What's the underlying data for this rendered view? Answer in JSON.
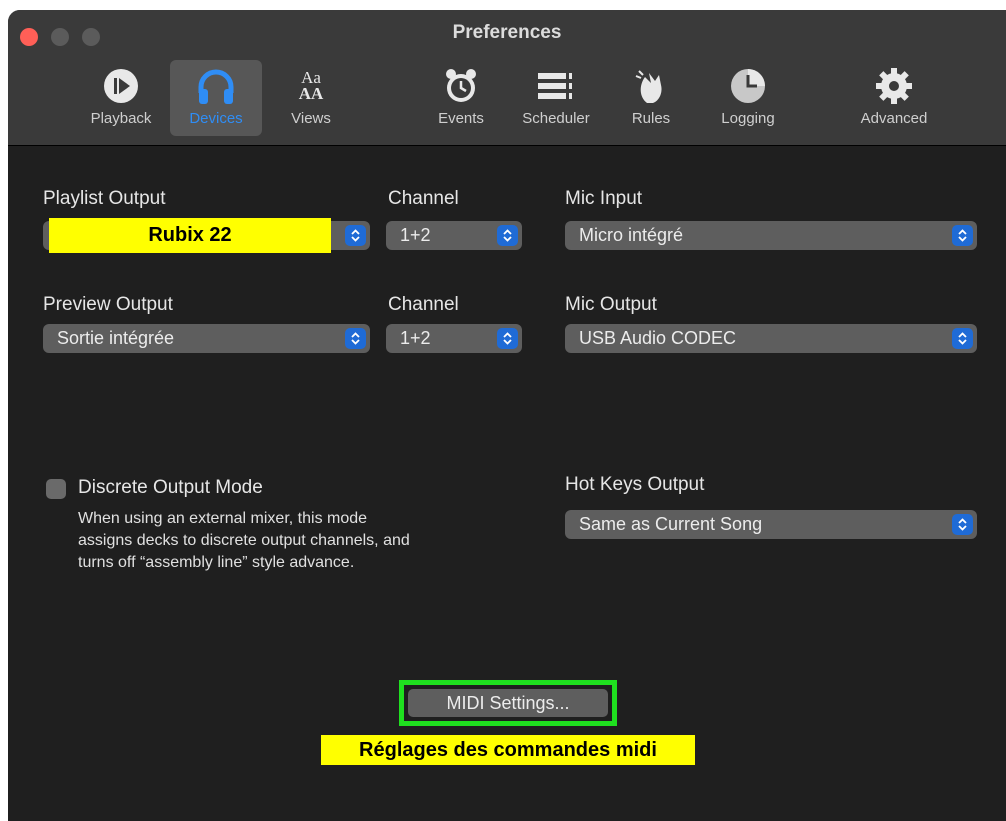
{
  "window": {
    "title": "Preferences"
  },
  "toolbar": {
    "tabs": [
      {
        "label": "Playback",
        "icon": "play-circle-icon"
      },
      {
        "label": "Devices",
        "icon": "headphones-icon"
      },
      {
        "label": "Views",
        "icon": "font-size-icon",
        "glyph_top": "Aa",
        "glyph_bottom": "AA"
      },
      {
        "label": "Events",
        "icon": "alarm-clock-icon"
      },
      {
        "label": "Scheduler",
        "icon": "numbered-list-icon"
      },
      {
        "label": "Rules",
        "icon": "hands-icon"
      },
      {
        "label": "Logging",
        "icon": "pie-clock-icon"
      },
      {
        "label": "Advanced",
        "icon": "gear-icon"
      }
    ],
    "active_tab": "Devices"
  },
  "devices": {
    "playlist_output": {
      "label": "Playlist Output",
      "value": "Rubix 22"
    },
    "playlist_channel": {
      "label": "Channel",
      "value": "1+2"
    },
    "mic_input": {
      "label": "Mic Input",
      "value": "Micro intégré"
    },
    "preview_output": {
      "label": "Preview Output",
      "value": "Sortie intégrée"
    },
    "preview_channel": {
      "label": "Channel",
      "value": "1+2"
    },
    "mic_output": {
      "label": "Mic Output",
      "value": "USB Audio CODEC"
    },
    "discrete_mode": {
      "label": "Discrete Output Mode",
      "checked": false,
      "description_lines": [
        "When using an external mixer, this mode",
        "assigns decks to discrete output channels, and",
        "turns off “assembly line” style advance."
      ]
    },
    "hot_keys_output": {
      "label": "Hot Keys Output",
      "value": "Same as Current Song"
    },
    "midi_button": {
      "label": "MIDI Settings..."
    },
    "annotation": {
      "text": "Réglages des commandes midi"
    }
  },
  "colors": {
    "accent": "#2f8df5",
    "stepper": "#1f6bd6",
    "highlight_yellow": "#ffff00",
    "highlight_green": "#1fe01f",
    "close": "#ff5f57"
  }
}
